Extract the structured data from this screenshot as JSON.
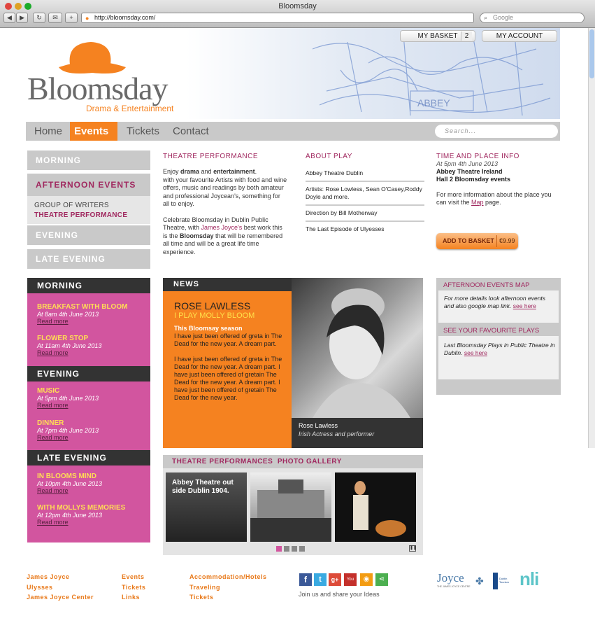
{
  "browser": {
    "title": "Bloomsday",
    "url": "http://bloomsday.com/",
    "search_placeholder": "Google"
  },
  "header": {
    "brand": "Bloomsday",
    "tagline": "Drama & Entertainment",
    "basket_label": "MY BASKET",
    "basket_count": "2",
    "account_label": "MY ACCOUNT"
  },
  "nav": {
    "items": [
      "Home",
      "Events",
      "Tickets",
      "Contact"
    ],
    "search_placeholder": "Search..."
  },
  "left_menu": {
    "morning": "MORNING",
    "afternoon": "AFTERNOON EVENTS",
    "sub1": "GROUP OF WRITERS",
    "sub2": "THEATRE PERFORMANCE",
    "evening": "EVENING",
    "late": "LATE EVENING"
  },
  "schedule": {
    "morning": {
      "title": "MORNING",
      "events": [
        {
          "name": "BREAKFAST WITH BLOOM",
          "date": "At 8am 4th June 2013",
          "link": "Read more"
        },
        {
          "name": "FLOWER STOP",
          "date": "At 11am 4th June 2013",
          "link": "Read more"
        }
      ]
    },
    "evening": {
      "title": "EVENING",
      "events": [
        {
          "name": "MUSIC",
          "date": "At 5pm 4th June 2013",
          "link": "Read more"
        },
        {
          "name": "DINNER",
          "date": "At 7pm 4th June 2013",
          "link": "Read more"
        }
      ]
    },
    "late": {
      "title": "LATE EVENING",
      "events": [
        {
          "name": "IN BLOOMS MIND",
          "date": "At 10pm 4th June 2013",
          "link": "Read more"
        },
        {
          "name": "WITH MOLLYS MEMORIES",
          "date": "At 12pm 4th June 2013",
          "link": "Read more"
        }
      ]
    }
  },
  "theatre": {
    "heading": "THEATRE PERFORMANCE",
    "p1_a": "Enjoy ",
    "p1_b": "drama",
    "p1_c": " and ",
    "p1_d": "entertainment",
    "p1_e": ".",
    "p1_f": "with your favourite Artists with food and wine offers, music and readings by both amateur and professional Joycean's, something for all to enjoy.",
    "p2_a": "Celebrate Bloomsday in Dublin Public Theatre, with ",
    "p2_link": "James Joyce's",
    "p2_b": " best work this is the ",
    "p2_bold": "Bloomsday",
    "p2_c": " that will be remembered all time and will be a great life time experience."
  },
  "about": {
    "heading": "ABOUT PLAY",
    "rows": [
      "Abbey Theatre Dublin",
      "Artists: Rose Lowless, Sean O'Casey,Roddy Doyle and more.",
      "Direction by Bill Motherway",
      "The Last Episode of Ulyesses"
    ]
  },
  "time_place": {
    "heading": "TIME AND PLACE INFO",
    "date": "At 5pm 4th June 2013",
    "venue": "Abbey Theatre Ireland",
    "hall": "Hall 2 Bloomsday events",
    "info_a": "For more information about the place you can visit the ",
    "info_link": "Map",
    "info_b": " page.",
    "add_btn": "ADD TO BASKET",
    "price": "€9.99"
  },
  "news": {
    "label": "NEWS",
    "name": "ROSE LAWLESS",
    "role": "I PLAY MOLLY BLOOM",
    "season": "This Bloomsay season",
    "text1": "I have just been offered of greta in The Dead for the new year. A dream part.",
    "text2": "I have just been offered of greta in The Dead for the new year. A dream part. I have just been offered of gretain The Dead for the new year. A dream part. I have just been offered of gretain The Dead for the new year.",
    "caption_name": "Rose Lawless",
    "caption_role": "Irish Actress and performer"
  },
  "sidebar": {
    "map_heading": "AFTERNOON EVENTS MAP",
    "map_text": "For more details look afternoon events and also google map link.",
    "map_link": "see here",
    "plays_heading": "SEE YOUR FAVOURITE PLAYS",
    "plays_text": "Last Bloomsday Plays in Public Theatre in Dublin.",
    "plays_link": "see here"
  },
  "gallery": {
    "heading": "THEATRE PERFORMANCES  PHOTO GALLERY",
    "photo1_caption": "Abbey Theatre out side Dublin 1904."
  },
  "footer": {
    "col1": [
      "James Joyce",
      "Ulysses",
      "James Joyce Center"
    ],
    "col2": [
      "Events",
      "Tickets",
      "Links"
    ],
    "col3": [
      "Accommodation/Hotels",
      "Traveling",
      "Tickets"
    ],
    "social_text": "Join us and share your Ideas",
    "logo_joyce": "Joyce",
    "logo_joyce_sub": "THE JAMES JOYCE CENTRE",
    "logo_dublin": "Dublin Tourism",
    "logo_nli": "nli"
  },
  "colors": {
    "orange": "#f58220",
    "pink": "#d2559f",
    "purple": "#a0285f",
    "dark": "#333333"
  }
}
